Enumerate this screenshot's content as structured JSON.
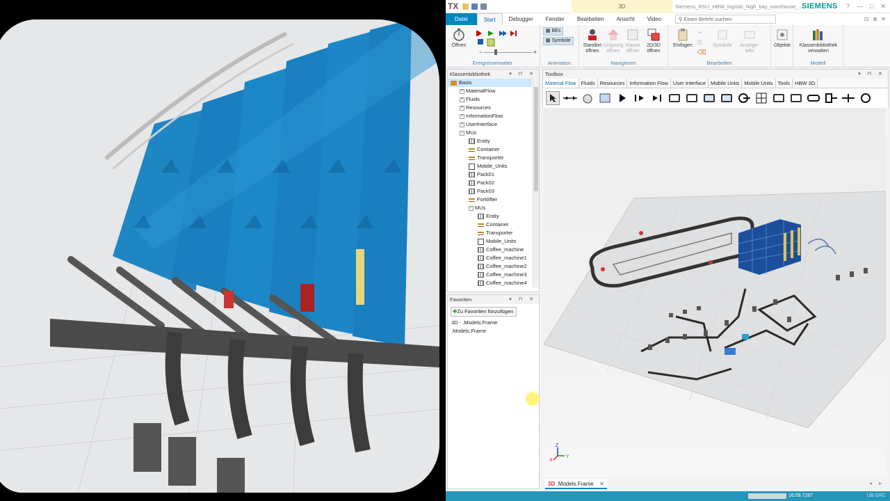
{
  "app": {
    "logo": "TX",
    "context_tab": "3D",
    "window_title": "Siemens_RSU_HBW_logistic_high_bay_warehouse_...",
    "brand": "SIEMENS",
    "window_controls": [
      "?",
      "—",
      "□",
      "✕"
    ]
  },
  "ribbon": {
    "tabs": [
      "Datei",
      "Start",
      "Debugger",
      "Fenster",
      "Bearbeiten",
      "Ansicht",
      "Video"
    ],
    "active_tab": "Start",
    "search_placeholder": "Einen Befehl suchen",
    "groups": {
      "event": {
        "open_label": "Öffnen",
        "label": "Ereignisverwalter"
      },
      "animation": {
        "bes": "BEs",
        "symbols": "Symbole",
        "label": "Animation"
      },
      "navigate": {
        "std": "Standort öffnen",
        "origin": "Ursprung öffnen",
        "klasse": "Klasse öffnen",
        "view2d3d": "2D/3D öffnen",
        "label": "Navigieren"
      },
      "edit": {
        "paste": "Einfügen",
        "symbole": "Symbole",
        "anzeige": "Anzeige-tafel",
        "label": "Bearbeiten"
      },
      "objects": {
        "obj": "Objekte"
      },
      "model": {
        "lib": "Klassenbibliothek verwalten",
        "label": "Modell"
      }
    }
  },
  "class_library": {
    "title": "Klassenbibliothek",
    "items": [
      {
        "label": "Basis",
        "level": 0,
        "kind": "root"
      },
      {
        "label": "MaterialFlow",
        "level": 1,
        "kind": "folder",
        "exp": "+"
      },
      {
        "label": "Fluids",
        "level": 1,
        "kind": "folder",
        "exp": "+"
      },
      {
        "label": "Resources",
        "level": 1,
        "kind": "folder",
        "exp": "+"
      },
      {
        "label": "InformationFlow",
        "level": 1,
        "kind": "folder",
        "exp": "+"
      },
      {
        "label": "UserInterface",
        "level": 1,
        "kind": "folder",
        "exp": "+"
      },
      {
        "label": "MUs",
        "level": 1,
        "kind": "folder",
        "exp": "−"
      },
      {
        "label": "Entity",
        "level": 2,
        "kind": "cls"
      },
      {
        "label": "Container",
        "level": 2,
        "kind": "tp"
      },
      {
        "label": "Transporter",
        "level": 2,
        "kind": "tp"
      },
      {
        "label": "Mobile_Units",
        "level": 2,
        "kind": "mu"
      },
      {
        "label": "Pack01",
        "level": 2,
        "kind": "cls"
      },
      {
        "label": "Pack02",
        "level": 2,
        "kind": "cls"
      },
      {
        "label": "Pack03",
        "level": 2,
        "kind": "cls"
      },
      {
        "label": "Forklifter",
        "level": 2,
        "kind": "tp"
      },
      {
        "label": "MUs",
        "level": 2,
        "kind": "folder",
        "exp": "−"
      },
      {
        "label": "Entity",
        "level": 3,
        "kind": "cls"
      },
      {
        "label": "Container",
        "level": 3,
        "kind": "tp"
      },
      {
        "label": "Transporter",
        "level": 3,
        "kind": "tp"
      },
      {
        "label": "Mobile_Units",
        "level": 3,
        "kind": "mu"
      },
      {
        "label": "Coffee_machine",
        "level": 3,
        "kind": "cls"
      },
      {
        "label": "Coffee_machine1",
        "level": 3,
        "kind": "cls"
      },
      {
        "label": "Coffee_machine2",
        "level": 3,
        "kind": "cls"
      },
      {
        "label": "Coffee_machine3",
        "level": 3,
        "kind": "cls"
      },
      {
        "label": "Coffee_machine4",
        "level": 3,
        "kind": "cls"
      }
    ]
  },
  "favorites": {
    "title": "Favoriten",
    "add_button": "Zu Favoriten hinzufügen",
    "items": [
      "3D - .Models.Frame",
      ".Models.Frame"
    ]
  },
  "toolbox": {
    "title": "Toolbox",
    "tabs": [
      "Material Flow",
      "Fluids",
      "Resources",
      "Information Flow",
      "User Interface",
      "Mobile Units",
      "Mobile Units",
      "Tools",
      "HBW 3D"
    ],
    "active_tab": "Material Flow"
  },
  "viewport": {
    "axes": {
      "x": "X",
      "y": "Y",
      "z": "Z"
    }
  },
  "document_tab": {
    "prefix": "3D",
    "label": ".Models.Frame"
  },
  "status": {
    "time": "16:09.7287",
    "right": "ÜB  GRC"
  }
}
